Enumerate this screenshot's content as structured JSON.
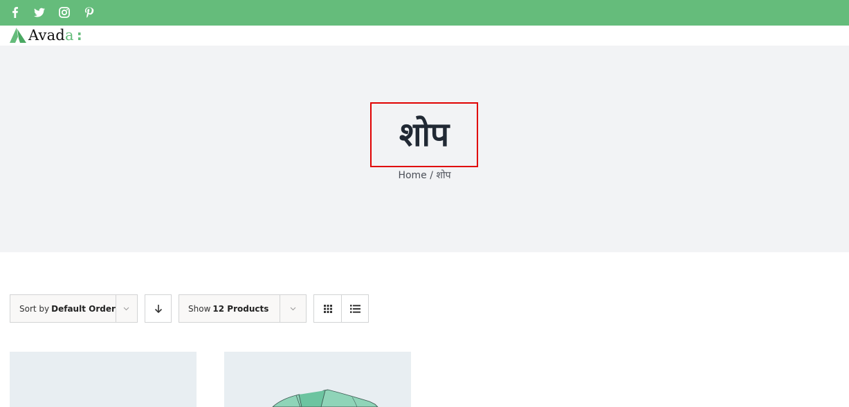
{
  "topbar": {
    "color": "#65bc7b",
    "social_icons": [
      "facebook-icon",
      "twitter-icon",
      "instagram-icon",
      "pinterest-icon"
    ]
  },
  "header": {
    "logo": {
      "text_main": "Avad",
      "text_accent": "a",
      "suffix": ":"
    }
  },
  "page_title": {
    "title": "शोप",
    "breadcrumb": {
      "home": "Home",
      "separator": "/",
      "current": "शोप"
    }
  },
  "shop_controls": {
    "sort": {
      "prefix": "Sort by",
      "value": "Default Order"
    },
    "sort_direction_icon": "arrow-down-icon",
    "show": {
      "prefix": "Show",
      "value": "12 Products"
    },
    "views": [
      "grid-view",
      "list-view"
    ]
  },
  "products": [
    {
      "image": "blank-placeholder"
    },
    {
      "image": "green-tshirt"
    }
  ]
}
